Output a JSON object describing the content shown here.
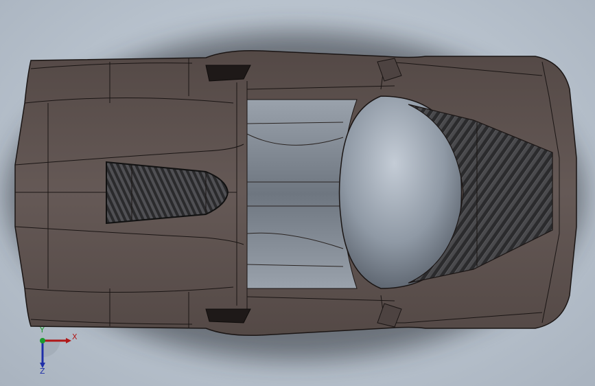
{
  "viewport": {
    "background_top": "#bfc8d2",
    "background_bottom": "#a9b3bf"
  },
  "model": {
    "body_color": "#5e5350",
    "body_dark": "#3e3634",
    "edge_color": "#1a1514",
    "canopy_light": "#b7c1cc",
    "canopy_dark": "#59616d",
    "carbon_fiber": "#2c2c2e"
  },
  "triad": {
    "x_label": "X",
    "y_label": "Y",
    "z_label": "Z",
    "x_color": "#b01818",
    "y_color": "#1c9a2b",
    "z_color": "#1f2fa8"
  }
}
